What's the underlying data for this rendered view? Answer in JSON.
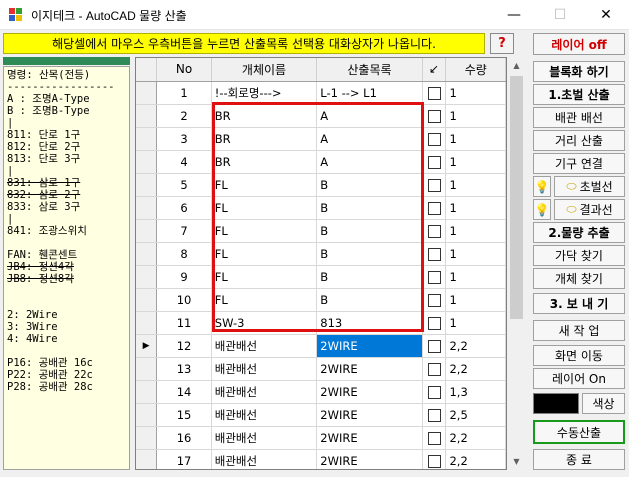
{
  "window": {
    "title": "이지테크 - AutoCAD 물량 산출",
    "min_glyph": "—",
    "max_glyph": "☐",
    "close_glyph": "✕"
  },
  "banner": {
    "text": "해당셀에서 마우스 우측버튼을 누르면 산출목록 선택용 대화상자가 나옵니다."
  },
  "help_label": "?",
  "layer_off_label": "레이어 off",
  "left_panel": {
    "lines": [
      {
        "text": "명령: 산목(전등)",
        "strike": false
      },
      {
        "text": "-----------------",
        "strike": false
      },
      {
        "text": "A : 조명A-Type",
        "strike": false
      },
      {
        "text": "B : 조명B-Type",
        "strike": false
      },
      {
        "text": "|",
        "strike": false
      },
      {
        "text": "811: 단로 1구",
        "strike": false
      },
      {
        "text": "812: 단로 2구",
        "strike": false
      },
      {
        "text": "813: 단로 3구",
        "strike": false
      },
      {
        "text": "|",
        "strike": false
      },
      {
        "text": "831: 삼로 1구",
        "strike": true
      },
      {
        "text": "832: 삼로 2구",
        "strike": true
      },
      {
        "text": "833: 삼로 3구",
        "strike": false
      },
      {
        "text": "|",
        "strike": false
      },
      {
        "text": "841: 조광스위치",
        "strike": false
      },
      {
        "text": "",
        "strike": false
      },
      {
        "text": "FAN: 휀콘센트",
        "strike": false
      },
      {
        "text": "JB4: 정션4각",
        "strike": true
      },
      {
        "text": "JB8: 정션8각",
        "strike": true
      },
      {
        "text": "",
        "strike": false
      },
      {
        "text": "",
        "strike": false
      },
      {
        "text": "2: 2Wire",
        "strike": false
      },
      {
        "text": "3: 3Wire",
        "strike": false
      },
      {
        "text": "4: 4Wire",
        "strike": false
      },
      {
        "text": "",
        "strike": false
      },
      {
        "text": "P16: 공배관 16c",
        "strike": false
      },
      {
        "text": "P22: 공배관 22c",
        "strike": false
      },
      {
        "text": "P28: 공배관 28c",
        "strike": false
      }
    ]
  },
  "grid": {
    "columns": [
      "No",
      "개체이름",
      "산출목록",
      "↙",
      "수량"
    ],
    "rows": [
      {
        "no": "1",
        "name": "!--회로명--->",
        "item": "L-1 --> L1",
        "qty": "1",
        "current": false,
        "selected": false
      },
      {
        "no": "2",
        "name": "BR",
        "item": "A",
        "qty": "1",
        "current": false,
        "selected": false
      },
      {
        "no": "3",
        "name": "BR",
        "item": "A",
        "qty": "1",
        "current": false,
        "selected": false
      },
      {
        "no": "4",
        "name": "BR",
        "item": "A",
        "qty": "1",
        "current": false,
        "selected": false
      },
      {
        "no": "5",
        "name": "FL",
        "item": "B",
        "qty": "1",
        "current": false,
        "selected": false
      },
      {
        "no": "6",
        "name": "FL",
        "item": "B",
        "qty": "1",
        "current": false,
        "selected": false
      },
      {
        "no": "7",
        "name": "FL",
        "item": "B",
        "qty": "1",
        "current": false,
        "selected": false
      },
      {
        "no": "8",
        "name": "FL",
        "item": "B",
        "qty": "1",
        "current": false,
        "selected": false
      },
      {
        "no": "9",
        "name": "FL",
        "item": "B",
        "qty": "1",
        "current": false,
        "selected": false
      },
      {
        "no": "10",
        "name": "FL",
        "item": "B",
        "qty": "1",
        "current": false,
        "selected": false
      },
      {
        "no": "11",
        "name": "SW-3",
        "item": "813",
        "qty": "1",
        "current": false,
        "selected": false
      },
      {
        "no": "12",
        "name": "배관배선",
        "item": "2WIRE",
        "qty": "2,2",
        "current": true,
        "selected": true
      },
      {
        "no": "13",
        "name": "배관배선",
        "item": "2WIRE",
        "qty": "2,2",
        "current": false,
        "selected": false
      },
      {
        "no": "14",
        "name": "배관배선",
        "item": "2WIRE",
        "qty": "1,3",
        "current": false,
        "selected": false
      },
      {
        "no": "15",
        "name": "배관배선",
        "item": "2WIRE",
        "qty": "2,5",
        "current": false,
        "selected": false
      },
      {
        "no": "16",
        "name": "배관배선",
        "item": "2WIRE",
        "qty": "2,2",
        "current": false,
        "selected": false
      },
      {
        "no": "17",
        "name": "배관배선",
        "item": "2WIRE",
        "qty": "2,2",
        "current": false,
        "selected": false
      }
    ]
  },
  "right_panel": {
    "block_label": "블록화 하기",
    "section1_label": "1.초벌 산출",
    "pipe_wire_label": "배관 배선",
    "distance_label": "거리 산출",
    "fixture_link_label": "기구 연결",
    "draft_line_label": "초벌선",
    "result_line_label": "결과선",
    "section2_label": "2.물량 추출",
    "branch_find_label": "가닥 찾기",
    "object_find_label": "개체 찾기",
    "section3_label": "3. 보 내 기",
    "new_work_label": "새 작 업",
    "screen_move_label": "화면 이동",
    "layer_on_label": "레이어 On",
    "color_label": "색상",
    "manual_calc_label": "수동산출",
    "exit_label": "종 료",
    "bulb_icon_glyph": "💡",
    "eraser_icon_glyph": "⬭",
    "accent_color": "#1a9a1a",
    "swatch_color": "#000000"
  },
  "row_pointer_glyph": "▶"
}
